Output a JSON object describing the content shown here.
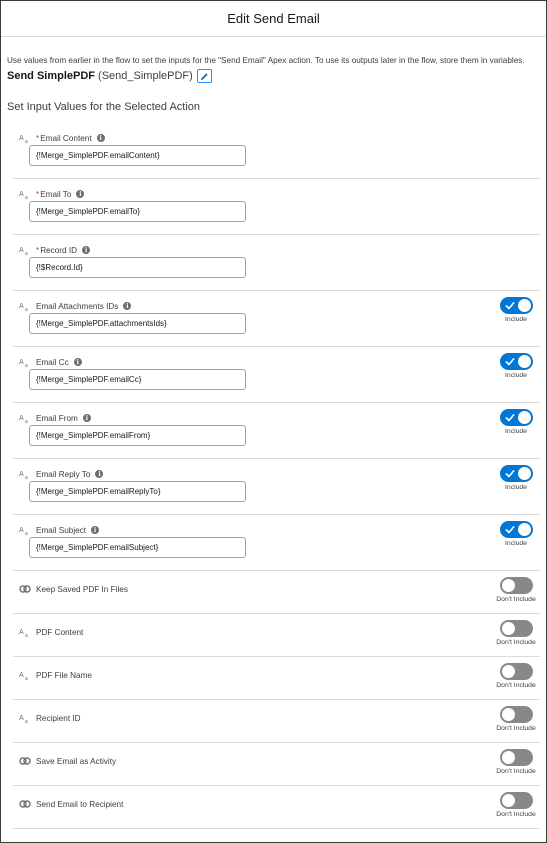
{
  "header": {
    "title": "Edit Send Email"
  },
  "intro": {
    "text": "Use values from earlier in the flow to set the inputs for the \"Send Email\" Apex action. To use its outputs later in the flow, store them in variables."
  },
  "action": {
    "label": "Send SimplePDF",
    "api_name": "(Send_SimplePDF)",
    "edit_icon": "pencil-icon"
  },
  "section": {
    "title": "Set Input Values for the Selected Action"
  },
  "toggle_labels": {
    "include": "Include",
    "dont_include": "Don't Include"
  },
  "params": [
    {
      "label": "Email Content",
      "required": "*",
      "type_icon": "text-type-icon",
      "info": "i",
      "value": "{!Merge_SimplePDF.emailContent}",
      "toggle": null
    },
    {
      "label": "Email To",
      "required": "*",
      "type_icon": "text-type-icon",
      "info": "i",
      "value": "{!Merge_SimplePDF.emailTo}",
      "toggle": null
    },
    {
      "label": "Record ID",
      "required": "*",
      "type_icon": "text-type-icon",
      "info": "i",
      "value": "{!$Record.Id}",
      "toggle": null
    },
    {
      "label": "Email Attachments IDs",
      "required": "",
      "type_icon": "text-type-icon",
      "info": "i",
      "value": "{!Merge_SimplePDF.attachmentsIds}",
      "toggle": "on"
    },
    {
      "label": "Email Cc",
      "required": "",
      "type_icon": "text-type-icon",
      "info": "i",
      "value": "{!Merge_SimplePDF.emailCc}",
      "toggle": "on"
    },
    {
      "label": "Email From",
      "required": "",
      "type_icon": "text-type-icon",
      "info": "i",
      "value": "{!Merge_SimplePDF.emailFrom}",
      "toggle": "on"
    },
    {
      "label": "Email Reply To",
      "required": "",
      "type_icon": "text-type-icon",
      "info": "i",
      "value": "{!Merge_SimplePDF.emailReplyTo}",
      "toggle": "on"
    },
    {
      "label": "Email Subject",
      "required": "",
      "type_icon": "text-type-icon",
      "info": "i",
      "value": "{!Merge_SimplePDF.emailSubject}",
      "toggle": "on"
    },
    {
      "label": "Keep Saved PDF In Files",
      "required": "",
      "type_icon": "boolean-type-icon",
      "info": "",
      "value": null,
      "toggle": "off"
    },
    {
      "label": "PDF Content",
      "required": "",
      "type_icon": "text-type-icon",
      "info": "",
      "value": null,
      "toggle": "off"
    },
    {
      "label": "PDF File Name",
      "required": "",
      "type_icon": "text-type-icon",
      "info": "",
      "value": null,
      "toggle": "off"
    },
    {
      "label": "Recipient ID",
      "required": "",
      "type_icon": "text-type-icon",
      "info": "",
      "value": null,
      "toggle": "off"
    },
    {
      "label": "Save Email as Activity",
      "required": "",
      "type_icon": "boolean-type-icon",
      "info": "",
      "value": null,
      "toggle": "off"
    },
    {
      "label": "Send Email to Recipient",
      "required": "",
      "type_icon": "boolean-type-icon",
      "info": "",
      "value": null,
      "toggle": "off"
    }
  ],
  "colors": {
    "toggle_on": "#0176d3",
    "toggle_off": "#8a8886",
    "edit_border": "#1b96ff"
  }
}
